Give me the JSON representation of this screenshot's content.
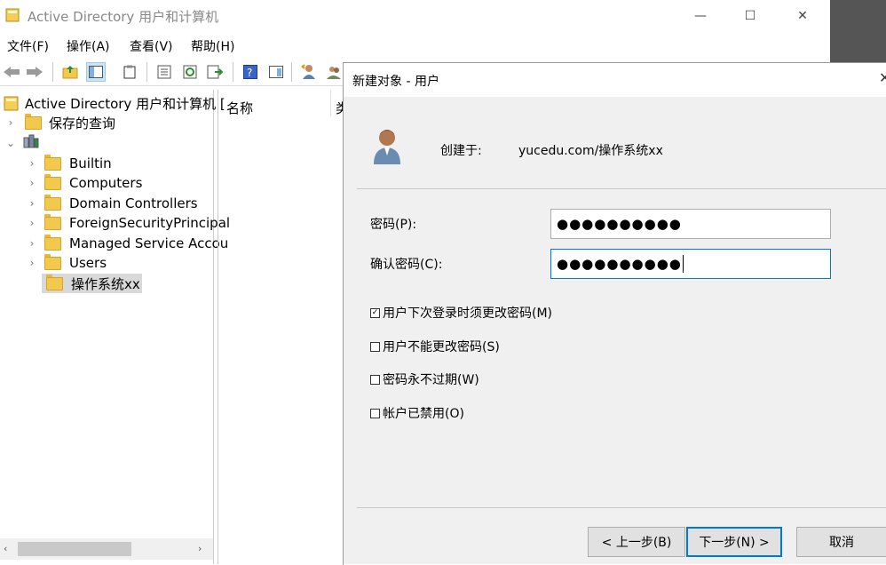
{
  "window": {
    "title": "Active Directory 用户和计算机",
    "minimize": "—",
    "maximize": "☐",
    "close": "✕"
  },
  "menu": [
    "文件(F)",
    "操作(A)",
    "查看(V)",
    "帮助(H)"
  ],
  "tree": {
    "root": "Active Directory 用户和计算机 [",
    "saved_queries": "保存的查询",
    "domain_redacted": "",
    "children": [
      "Builtin",
      "Computers",
      "Domain Controllers",
      "ForeignSecurityPrincipal",
      "Managed Service Accou",
      "Users",
      "操作系统xx"
    ]
  },
  "list": {
    "col_name": "名称",
    "col_type_partial": "类"
  },
  "dialog": {
    "title": "新建对象 - 用户",
    "created_in_label": "创建于:",
    "created_in_value": "yucedu.com/操作系统xx",
    "password_label": "密码(P):",
    "password_value": "●●●●●●●●●●",
    "confirm_label": "确认密码(C):",
    "confirm_value": "●●●●●●●●●●",
    "options": [
      {
        "label": "用户下次登录时须更改密码(M)",
        "checked": true
      },
      {
        "label": "用户不能更改密码(S)",
        "checked": false
      },
      {
        "label": "密码永不过期(W)",
        "checked": false
      },
      {
        "label": "帐户已禁用(O)",
        "checked": false
      }
    ],
    "checked_glyph": "✓",
    "back_button": "< 上一步(B)",
    "next_button": "下一步(N) >",
    "cancel_button": "取消",
    "accent_color": "#0078d7"
  }
}
